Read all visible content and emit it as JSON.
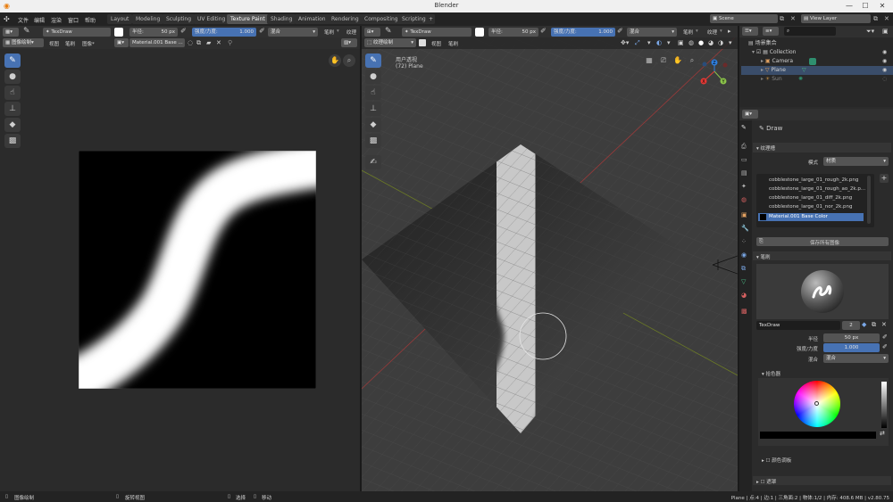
{
  "window": {
    "title": "Blender"
  },
  "menu": [
    "文件",
    "编辑",
    "渲染",
    "窗口",
    "帮助"
  ],
  "workspaces": [
    {
      "label": "Layout",
      "active": false
    },
    {
      "label": "Modeling",
      "active": false
    },
    {
      "label": "Sculpting",
      "active": false
    },
    {
      "label": "UV Editing",
      "active": false
    },
    {
      "label": "Texture Paint",
      "active": true
    },
    {
      "label": "Shading",
      "active": false
    },
    {
      "label": "Animation",
      "active": false
    },
    {
      "label": "Rendering",
      "active": false
    },
    {
      "label": "Compositing",
      "active": false
    },
    {
      "label": "Scripting",
      "active": false
    }
  ],
  "scene": {
    "label": "Scene"
  },
  "view_layer": {
    "label": "View Layer"
  },
  "image_editor": {
    "brush_name": "TexDraw",
    "radius_label": "半径",
    "radius_value": "50 px",
    "strength_label": "强度/力度",
    "strength_value": "1.000",
    "blend": "混合",
    "brush_menu": "笔刷",
    "texture_menu": "纹理",
    "mode": "图像绘制",
    "view_menu": "视图",
    "brush_menu2": "笔刷",
    "image_menu": "图像*",
    "image_name": "Material.001 Base ..."
  },
  "viewport": {
    "brush_name": "TexDraw",
    "radius_label": "半径",
    "radius_value": "50 px",
    "strength_label": "强度/力度",
    "strength_value": "1.000",
    "blend": "混合",
    "brush_menu": "笔刷",
    "texture_menu": "纹理",
    "mode": "纹理绘制",
    "view_menu": "视图",
    "brush_menu2": "笔刷",
    "overlay_line1": "用户透视",
    "overlay_line2": "(72) Plane",
    "gizmo_x": "X",
    "gizmo_y": "Y",
    "gizmo_z": "Z"
  },
  "outliner": {
    "root": "场景集合",
    "collection": "Collection",
    "items": [
      "Camera",
      "Plane",
      "Sun"
    ]
  },
  "properties": {
    "brush_title": "Draw",
    "texture_slots_label": "纹理槽",
    "mode_label": "模式",
    "mode_value": "材质",
    "slots": [
      "cobblestone_large_01_rough_2k.png",
      "cobblestone_large_01_rough_ao_2k.p...",
      "cobblestone_large_01_diff_2k.png",
      "cobblestone_large_01_nor_2k.png",
      "Material.001 Base Color"
    ],
    "selected_slot_index": 4,
    "save_all_label": "保存所有图像",
    "brush_section": "笔刷",
    "brush_name": "TexDraw",
    "brush_users": "2",
    "radius_label": "半径",
    "radius_value": "50 px",
    "strength_label": "强度/力度",
    "strength_value": "1.000",
    "blend_label": "混合",
    "blend_value": "混合",
    "color_picker_label": "拾色器",
    "color_palette_label": "颜色调板",
    "mask_label": "遮罩"
  },
  "status": {
    "left": "图像绘制",
    "middle1": "旋转视图",
    "middle2": "选择",
    "middle3": "移动",
    "right": "Plane | 点:4 | 边:1 | 三角面:2 | 物体:1/2 | 内存: 408.6 MB | v2.80.75"
  },
  "colors": {
    "accent": "#4772b3",
    "header": "#303030",
    "background": "#2b2b2b",
    "viewport_bg": "#3d3d3d"
  }
}
